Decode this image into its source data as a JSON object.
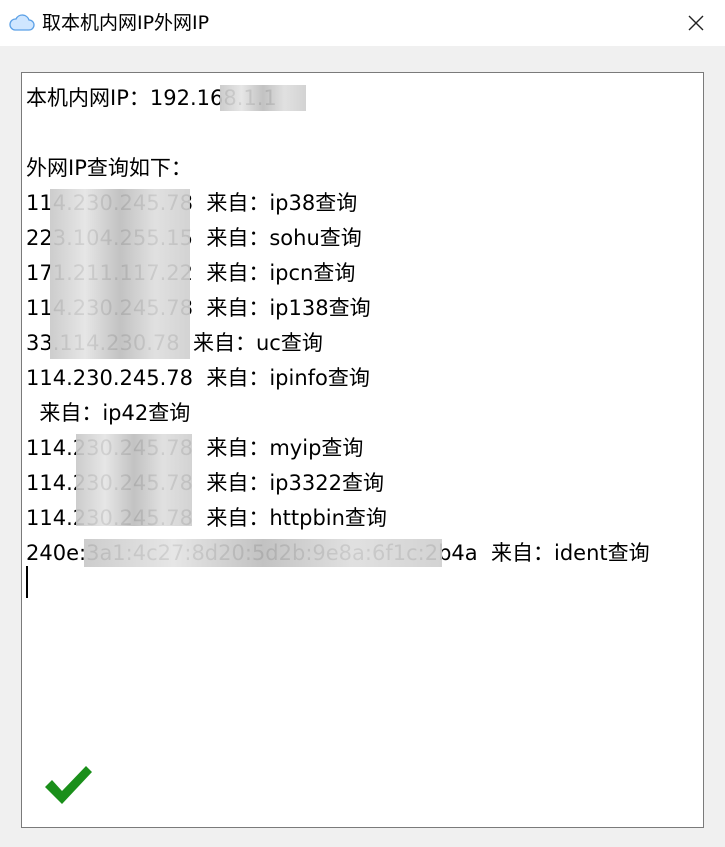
{
  "window": {
    "title": "取本机内网IP外网IP",
    "app_icon": "cloud-icon",
    "close_icon": "close-icon"
  },
  "output": {
    "lines": [
      "本机内网IP：192.168.1.1",
      "",
      "外网IP查询如下：",
      "114.230.245.78  来自：ip38查询",
      "223.104.255.15  来自：sohu查询",
      "171.211.117.22  来自：ipcn查询",
      "114.230.245.78  来自：ip138查询",
      "33.114.230.78  来自：uc查询",
      "114.230.245.78  来自：ipinfo查询",
      "  来自：ip42查询",
      "114.230.245.78  来自：myip查询",
      "114.230.245.78  来自：ip3322查询",
      "114.230.245.78  来自：httpbin查询",
      "240e:3a1:4c27:8d20:5d2b:9e8a:6f1c:2b4a  来自：ident查询"
    ]
  },
  "status": {
    "icon": "checkmark-icon",
    "color": "#1a8f1a"
  }
}
